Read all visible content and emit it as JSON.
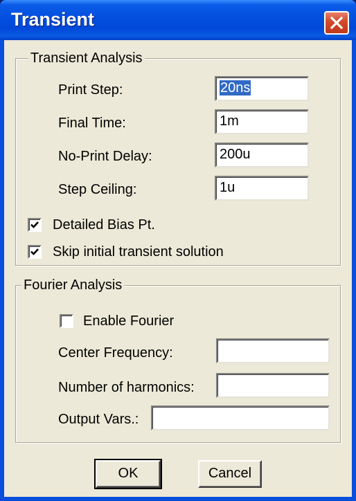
{
  "window": {
    "title": "Transient"
  },
  "transient_analysis": {
    "group_title": "Transient Analysis",
    "print_step": {
      "label": "Print Step:",
      "value": "20ns"
    },
    "final_time": {
      "label": "Final Time:",
      "value": "1m"
    },
    "no_print_delay": {
      "label": "No-Print Delay:",
      "value": "200u"
    },
    "step_ceiling": {
      "label": "Step Ceiling:",
      "value": "1u"
    },
    "detailed_bias": {
      "label": "Detailed Bias Pt.",
      "checked": true
    },
    "skip_initial": {
      "label": "Skip initial transient solution",
      "checked": true
    }
  },
  "fourier_analysis": {
    "group_title": "Fourier Analysis",
    "enable_fourier": {
      "label": "Enable Fourier",
      "checked": false
    },
    "center_frequency": {
      "label": "Center Frequency:",
      "value": ""
    },
    "harmonics": {
      "label": "Number of harmonics:",
      "value": ""
    },
    "output_vars": {
      "label": "Output Vars.:",
      "value": ""
    }
  },
  "buttons": {
    "ok": "OK",
    "cancel": "Cancel"
  },
  "icons": {
    "close": "close-icon",
    "check": "check-icon"
  },
  "colors": {
    "titlebar": "#0054e3",
    "client_bg": "#ece9d8",
    "close_button": "#d0492a",
    "selection": "#316ac5"
  }
}
